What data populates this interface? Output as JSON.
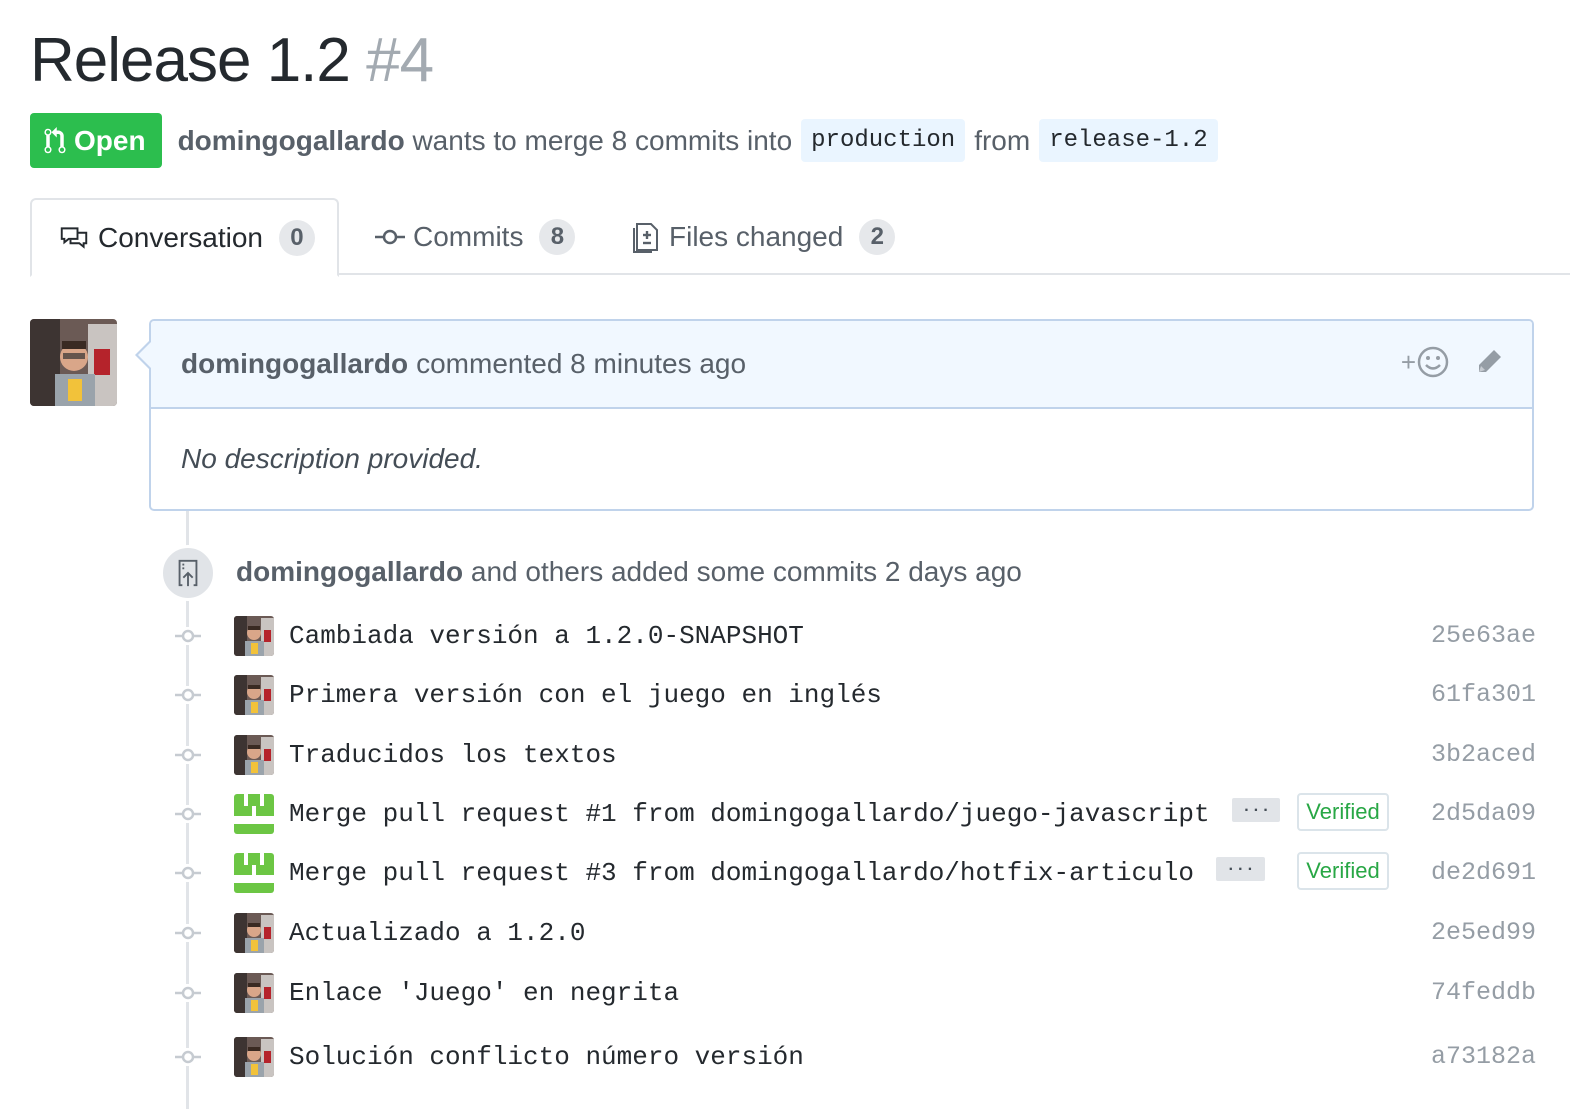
{
  "pr": {
    "title": "Release 1.2",
    "number": "#4",
    "state_label": "Open",
    "author": "domingogallardo",
    "merge_text_1": "wants to merge 8 commits into",
    "base_branch": "production",
    "merge_text_2": "from",
    "head_branch": "release-1.2"
  },
  "tabs": [
    {
      "label": "Conversation",
      "count": "0",
      "icon": "comment-discussion-icon",
      "selected": true
    },
    {
      "label": "Commits",
      "count": "8",
      "icon": "git-commit-icon",
      "selected": false
    },
    {
      "label": "Files changed",
      "count": "2",
      "icon": "diff-icon",
      "selected": false
    }
  ],
  "comment": {
    "author": "domingogallardo",
    "action": "commented 8 minutes ago",
    "reaction_plus": "+",
    "body": "No description provided."
  },
  "event": {
    "author": "domingogallardo",
    "text": "and others added some commits 2 days ago"
  },
  "commits": [
    {
      "message": "Cambiada versión a 1.2.0-SNAPSHOT",
      "sha": "25e63ae",
      "avatar": "user"
    },
    {
      "message": "Primera versión con el juego en inglés",
      "sha": "61fa301",
      "avatar": "user"
    },
    {
      "message": "Traducidos los textos",
      "sha": "3b2aced",
      "avatar": "user"
    },
    {
      "message": "Merge pull request #1 from domingogallardo/juego-javascript",
      "sha": "2d5da09",
      "avatar": "github",
      "ellipsis": "···",
      "verified": "Verified"
    },
    {
      "message": "Merge pull request #3 from domingogallardo/hotfix-articulo",
      "sha": "de2d691",
      "avatar": "github",
      "ellipsis": "···",
      "verified": "Verified"
    },
    {
      "message": "Actualizado a 1.2.0",
      "sha": "2e5ed99",
      "avatar": "user"
    },
    {
      "message": "Enlace 'Juego' en negrita",
      "sha": "74feddb",
      "avatar": "user"
    },
    {
      "message": "Solución conflicto número versión",
      "sha": "a73182a",
      "avatar": "user"
    }
  ],
  "colors": {
    "open_green": "#2cbe4e",
    "verified_green": "#28a745",
    "comment_header_bg": "#f1f8ff",
    "comment_border": "#c0d3eb"
  }
}
